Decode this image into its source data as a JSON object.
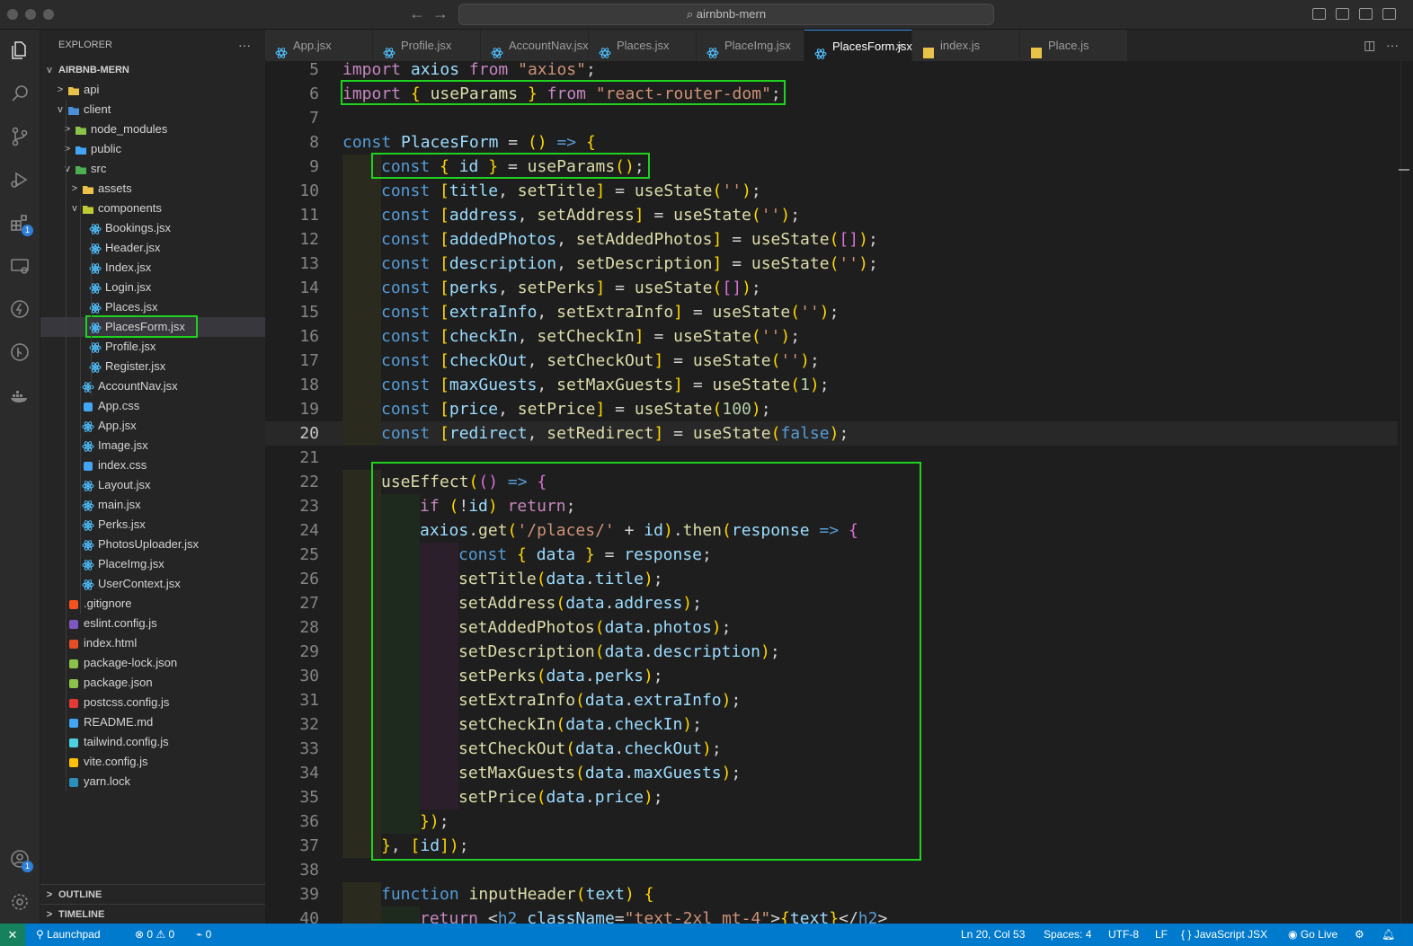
{
  "window": {
    "search_text": "airnbnb-mern"
  },
  "explorer": {
    "title": "EXPLORER",
    "root": "AIRBNB-MERN",
    "rows": [
      {
        "label": "api",
        "icon": "folder-api-icon",
        "chev": ">"
      },
      {
        "label": "client",
        "icon": "folder-client-icon",
        "chev": "v"
      },
      {
        "label": "node_modules",
        "icon": "folder-node-icon",
        "chev": ">"
      },
      {
        "label": "public",
        "icon": "folder-public-icon",
        "chev": ">"
      },
      {
        "label": "src",
        "icon": "folder-src-icon",
        "chev": "v"
      },
      {
        "label": "assets",
        "icon": "folder-icon",
        "chev": ">"
      },
      {
        "label": "components",
        "icon": "folder-components-icon",
        "chev": "v"
      },
      {
        "label": "Bookings.jsx",
        "icon": "react-icon"
      },
      {
        "label": "Header.jsx",
        "icon": "react-icon"
      },
      {
        "label": "Index.jsx",
        "icon": "react-icon"
      },
      {
        "label": "Login.jsx",
        "icon": "react-icon"
      },
      {
        "label": "Places.jsx",
        "icon": "react-icon"
      },
      {
        "label": "PlacesForm.jsx",
        "icon": "react-icon"
      },
      {
        "label": "Profile.jsx",
        "icon": "react-icon"
      },
      {
        "label": "Register.jsx",
        "icon": "react-icon"
      },
      {
        "label": "AccountNav.jsx",
        "icon": "react-icon"
      },
      {
        "label": "App.css",
        "icon": "css-icon"
      },
      {
        "label": "App.jsx",
        "icon": "react-icon"
      },
      {
        "label": "Image.jsx",
        "icon": "react-icon"
      },
      {
        "label": "index.css",
        "icon": "css-icon"
      },
      {
        "label": "Layout.jsx",
        "icon": "react-icon"
      },
      {
        "label": "main.jsx",
        "icon": "react-icon"
      },
      {
        "label": "Perks.jsx",
        "icon": "react-icon"
      },
      {
        "label": "PhotosUploader.jsx",
        "icon": "react-icon"
      },
      {
        "label": "PlaceImg.jsx",
        "icon": "react-icon"
      },
      {
        "label": "UserContext.jsx",
        "icon": "react-icon"
      },
      {
        "label": ".gitignore",
        "icon": "git-icon"
      },
      {
        "label": "eslint.config.js",
        "icon": "eslint-icon"
      },
      {
        "label": "index.html",
        "icon": "html-icon"
      },
      {
        "label": "package-lock.json",
        "icon": "npm-icon"
      },
      {
        "label": "package.json",
        "icon": "npm-icon"
      },
      {
        "label": "postcss.config.js",
        "icon": "postcss-icon"
      },
      {
        "label": "README.md",
        "icon": "info-icon"
      },
      {
        "label": "tailwind.config.js",
        "icon": "tailwind-icon"
      },
      {
        "label": "vite.config.js",
        "icon": "vite-icon"
      },
      {
        "label": "yarn.lock",
        "icon": "yarn-icon"
      }
    ],
    "outline": "OUTLINE",
    "timeline": "TIMELINE"
  },
  "tabs": [
    {
      "label": "App.jsx",
      "icon": "react-icon"
    },
    {
      "label": "Profile.jsx",
      "icon": "react-icon"
    },
    {
      "label": "AccountNav.jsx",
      "icon": "react-icon"
    },
    {
      "label": "Places.jsx",
      "icon": "react-icon"
    },
    {
      "label": "PlaceImg.jsx",
      "icon": "react-icon"
    },
    {
      "label": "PlacesForm.jsx",
      "icon": "react-icon",
      "active": true
    },
    {
      "label": "index.js",
      "icon": "js-icon"
    },
    {
      "label": "Place.js",
      "icon": "js-icon"
    }
  ],
  "editor": {
    "first_line_number": 5,
    "current_line": 20,
    "lines": [
      "import axios from \"axios\";",
      "import { useParams } from \"react-router-dom\";",
      "",
      "const PlacesForm = () => {",
      "  const { id } = useParams();",
      "  const [title, setTitle] = useState('');",
      "  const [address, setAddress] = useState('');",
      "  const [addedPhotos, setAddedPhotos] = useState([]);",
      "  const [description, setDescription] = useState('');",
      "  const [perks, setPerks] = useState([]);",
      "  const [extraInfo, setExtraInfo] = useState('');",
      "  const [checkIn, setCheckIn] = useState('');",
      "  const [checkOut, setCheckOut] = useState('');",
      "  const [maxGuests, setMaxGuests] = useState(1);",
      "  const [price, setPrice] = useState(100);",
      "  const [redirect, setRedirect] = useState(false);",
      "",
      "  useEffect(() => {",
      "    if (!id) return;",
      "    axios.get('/places/' + id).then(response => {",
      "      const { data } = response;",
      "      setTitle(data.title);",
      "      setAddress(data.address);",
      "      setAddedPhotos(data.photos);",
      "      setDescription(data.description);",
      "      setPerks(data.perks);",
      "      setExtraInfo(data.extraInfo);",
      "      setCheckIn(data.checkIn);",
      "      setCheckOut(data.checkOut);",
      "      setMaxGuests(data.maxGuests);",
      "      setPrice(data.price);",
      "    });",
      "  }, [id]);",
      "",
      "  function inputHeader(text) {",
      "    return <h2 className=\"text-2xl mt-4\">{text}</h2>"
    ]
  },
  "statusbar": {
    "remote": "✕",
    "launchpad": "Launchpad",
    "errors": "0",
    "warnings": "0",
    "ports": "0",
    "position": "Ln 20, Col 53",
    "spaces": "Spaces: 4",
    "encoding": "UTF-8",
    "eol": "LF",
    "language": "JavaScript JSX",
    "golive": "Go Live"
  },
  "colors": {
    "accent": "#007acc",
    "highlight_box": "#1fd21f",
    "react_icon": "#4fc1ff",
    "folder": "#e8c249"
  }
}
